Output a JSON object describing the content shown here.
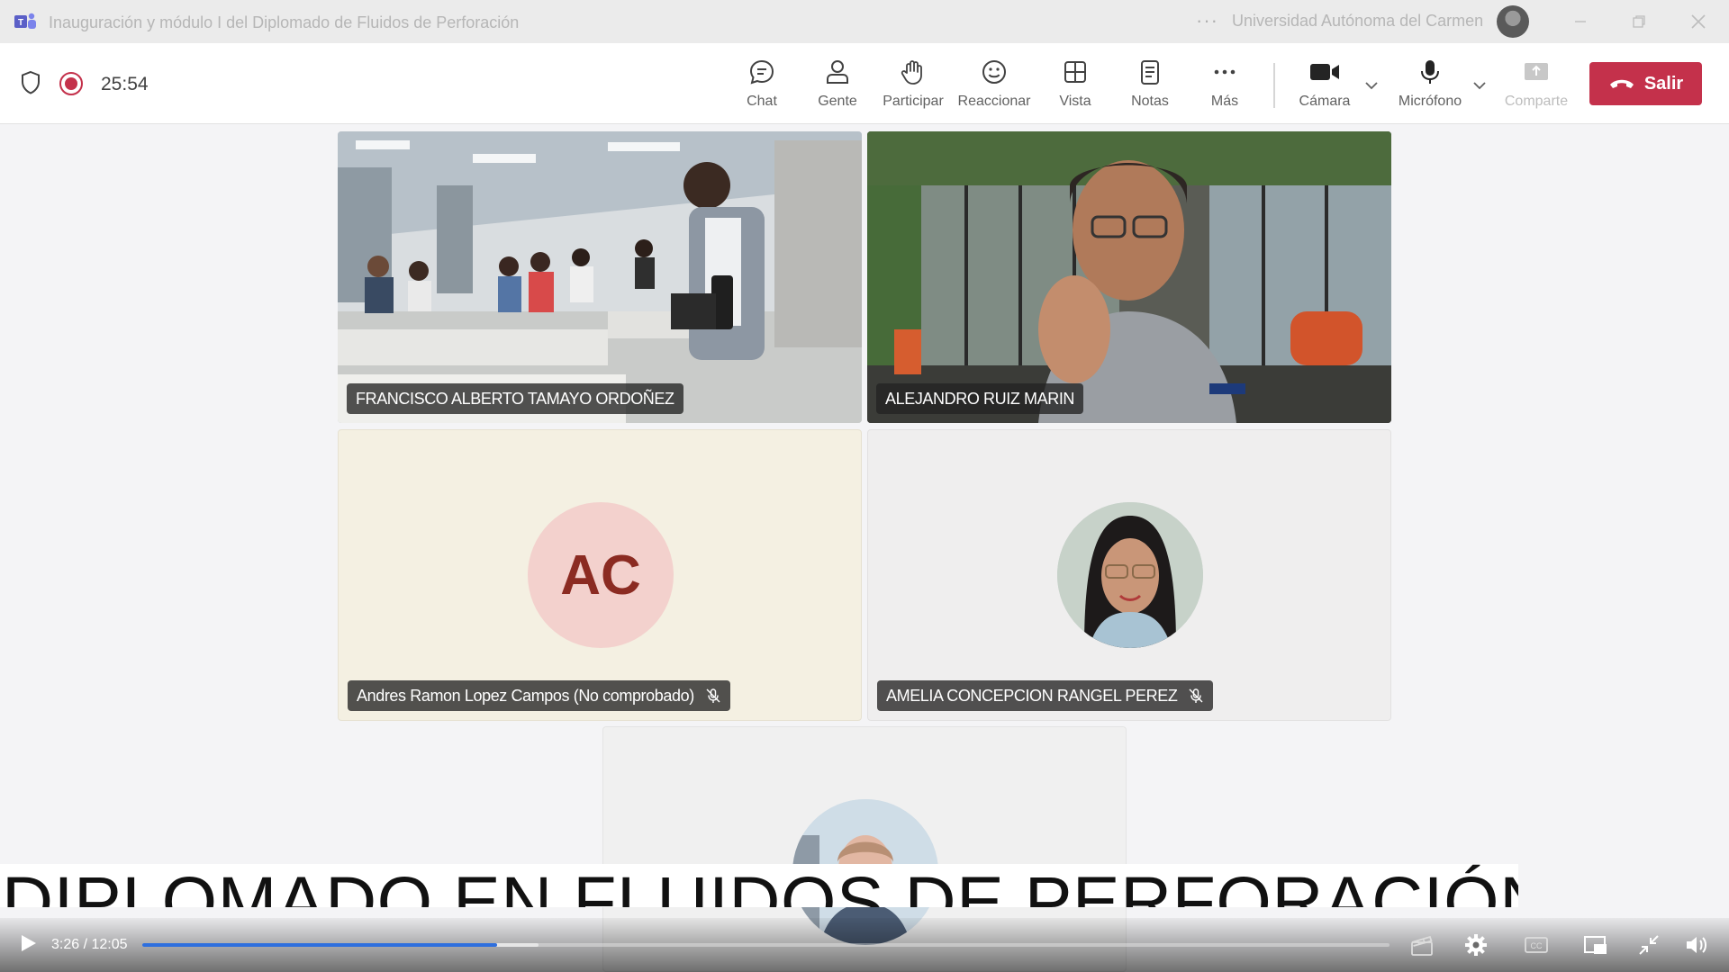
{
  "window": {
    "title": "Inauguración y módulo I del Diplomado de Fluidos de Perforación",
    "more": "···",
    "org_name": "Universidad Autónoma del Carmen"
  },
  "meeting": {
    "timer": "25:54",
    "toolbar": [
      {
        "id": "chat",
        "label": "Chat",
        "icon": "chat-icon"
      },
      {
        "id": "people",
        "label": "Gente",
        "icon": "people-icon"
      },
      {
        "id": "raise",
        "label": "Participar",
        "icon": "raise-hand-icon"
      },
      {
        "id": "react",
        "label": "Reaccionar",
        "icon": "smiley-icon"
      },
      {
        "id": "view",
        "label": "Vista",
        "icon": "grid-view-icon"
      },
      {
        "id": "notes",
        "label": "Notas",
        "icon": "notes-icon"
      },
      {
        "id": "more",
        "label": "Más",
        "icon": "more-icon"
      },
      {
        "id": "camera",
        "label": "Cámara",
        "icon": "camera-icon"
      },
      {
        "id": "mic",
        "label": "Micrófono",
        "icon": "mic-icon"
      },
      {
        "id": "share",
        "label": "Comparte",
        "icon": "share-icon"
      }
    ],
    "leave_label": "Salir",
    "leave_color": "#c4314b"
  },
  "participants": [
    {
      "name": "FRANCISCO ALBERTO TAMAYO ORDOÑEZ",
      "video": true,
      "muted": false
    },
    {
      "name": "ALEJANDRO RUIZ MARIN",
      "video": true,
      "muted": false
    },
    {
      "name": "Andres Ramon Lopez Campos (No comprobado)",
      "initials": "AC",
      "video": false,
      "muted": true
    },
    {
      "name": "AMELIA CONCEPCION RANGEL PEREZ",
      "video": false,
      "muted": true
    },
    {
      "name": "",
      "video": false,
      "muted": false
    }
  ],
  "caption": "DIPLOMADO EN FLUIDOS DE PERFORACIÓN",
  "player": {
    "time": "3:26 / 12:05",
    "progress": 0.2842,
    "progress_color": "#2e6fde"
  }
}
